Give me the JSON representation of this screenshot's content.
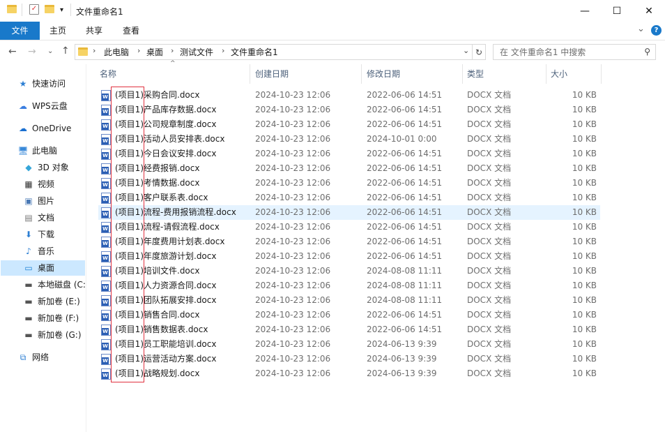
{
  "window": {
    "title": "文件重命名1",
    "minimize_glyph": "—",
    "maximize_glyph": "☐",
    "close_glyph": "✕"
  },
  "ribbon": {
    "tabs": [
      "文件",
      "主页",
      "共享",
      "查看"
    ],
    "expand_glyph": "⌄",
    "help_glyph": "?"
  },
  "address": {
    "breadcrumbs": [
      "此电脑",
      "桌面",
      "测试文件",
      "文件重命名1"
    ],
    "search_placeholder": "在 文件重命名1 中搜索"
  },
  "navpane": {
    "items": [
      {
        "label": "快速访问",
        "icon": "star-icon"
      },
      {
        "label": "WPS云盘",
        "icon": "cloud-icon"
      },
      {
        "label": "OneDrive",
        "icon": "onedrive-icon"
      },
      {
        "label": "此电脑",
        "icon": "computer-icon"
      },
      {
        "label": "3D 对象",
        "icon": "cube-icon"
      },
      {
        "label": "视频",
        "icon": "video-icon"
      },
      {
        "label": "图片",
        "icon": "picture-icon"
      },
      {
        "label": "文档",
        "icon": "document-icon"
      },
      {
        "label": "下载",
        "icon": "download-icon"
      },
      {
        "label": "音乐",
        "icon": "music-icon"
      },
      {
        "label": "桌面",
        "icon": "desktop-icon"
      },
      {
        "label": "本地磁盘 (C:",
        "icon": "drive-icon"
      },
      {
        "label": "新加卷 (E:)",
        "icon": "drive-icon"
      },
      {
        "label": "新加卷 (F:)",
        "icon": "drive-icon"
      },
      {
        "label": "新加卷 (G:)",
        "icon": "drive-icon"
      },
      {
        "label": "网络",
        "icon": "network-icon"
      }
    ]
  },
  "columns": {
    "name": "名称",
    "created": "创建日期",
    "modified": "修改日期",
    "type": "类型",
    "size": "大小"
  },
  "files": [
    {
      "name": "(项目1)采购合同.docx",
      "created": "2024-10-23 12:06",
      "modified": "2022-06-06 14:51",
      "type": "DOCX 文档",
      "size": "10 KB"
    },
    {
      "name": "(项目1)产品库存数据.docx",
      "created": "2024-10-23 12:06",
      "modified": "2022-06-06 14:51",
      "type": "DOCX 文档",
      "size": "10 KB"
    },
    {
      "name": "(项目1)公司规章制度.docx",
      "created": "2024-10-23 12:06",
      "modified": "2022-06-06 14:51",
      "type": "DOCX 文档",
      "size": "10 KB"
    },
    {
      "name": "(项目1)活动人员安排表.docx",
      "created": "2024-10-23 12:06",
      "modified": "2024-10-01 0:00",
      "type": "DOCX 文档",
      "size": "10 KB"
    },
    {
      "name": "(项目1)今日会议安排.docx",
      "created": "2024-10-23 12:06",
      "modified": "2022-06-06 14:51",
      "type": "DOCX 文档",
      "size": "10 KB"
    },
    {
      "name": "(项目1)经费报销.docx",
      "created": "2024-10-23 12:06",
      "modified": "2022-06-06 14:51",
      "type": "DOCX 文档",
      "size": "10 KB"
    },
    {
      "name": "(项目1)考情数据.docx",
      "created": "2024-10-23 12:06",
      "modified": "2022-06-06 14:51",
      "type": "DOCX 文档",
      "size": "10 KB"
    },
    {
      "name": "(项目1)客户联系表.docx",
      "created": "2024-10-23 12:06",
      "modified": "2022-06-06 14:51",
      "type": "DOCX 文档",
      "size": "10 KB"
    },
    {
      "name": "(项目1)流程-费用报销流程.docx",
      "created": "2024-10-23 12:06",
      "modified": "2022-06-06 14:51",
      "type": "DOCX 文档",
      "size": "10 KB"
    },
    {
      "name": "(项目1)流程-请假流程.docx",
      "created": "2024-10-23 12:06",
      "modified": "2022-06-06 14:51",
      "type": "DOCX 文档",
      "size": "10 KB"
    },
    {
      "name": "(项目1)年度费用计划表.docx",
      "created": "2024-10-23 12:06",
      "modified": "2022-06-06 14:51",
      "type": "DOCX 文档",
      "size": "10 KB"
    },
    {
      "name": "(项目1)年度旅游计划.docx",
      "created": "2024-10-23 12:06",
      "modified": "2022-06-06 14:51",
      "type": "DOCX 文档",
      "size": "10 KB"
    },
    {
      "name": "(项目1)培训文件.docx",
      "created": "2024-10-23 12:06",
      "modified": "2024-08-08 11:11",
      "type": "DOCX 文档",
      "size": "10 KB"
    },
    {
      "name": "(项目1)人力资源合同.docx",
      "created": "2024-10-23 12:06",
      "modified": "2024-08-08 11:11",
      "type": "DOCX 文档",
      "size": "10 KB"
    },
    {
      "name": "(项目1)团队拓展安排.docx",
      "created": "2024-10-23 12:06",
      "modified": "2024-08-08 11:11",
      "type": "DOCX 文档",
      "size": "10 KB"
    },
    {
      "name": "(项目1)销售合同.docx",
      "created": "2024-10-23 12:06",
      "modified": "2022-06-06 14:51",
      "type": "DOCX 文档",
      "size": "10 KB"
    },
    {
      "name": "(项目1)销售数据表.docx",
      "created": "2024-10-23 12:06",
      "modified": "2022-06-06 14:51",
      "type": "DOCX 文档",
      "size": "10 KB"
    },
    {
      "name": "(项目1)员工职能培训.docx",
      "created": "2024-10-23 12:06",
      "modified": "2024-06-13 9:39",
      "type": "DOCX 文档",
      "size": "10 KB"
    },
    {
      "name": "(项目1)运营活动方案.docx",
      "created": "2024-10-23 12:06",
      "modified": "2024-06-13 9:39",
      "type": "DOCX 文档",
      "size": "10 KB"
    },
    {
      "name": "(项目1)战略规划.docx",
      "created": "2024-10-23 12:06",
      "modified": "2024-06-13 9:39",
      "type": "DOCX 文档",
      "size": "10 KB"
    }
  ],
  "colors": {
    "accent": "#1979ca",
    "selection": "#cce8ff",
    "hover_row": "#e5f3ff",
    "highlight_box": "#e0313f"
  }
}
